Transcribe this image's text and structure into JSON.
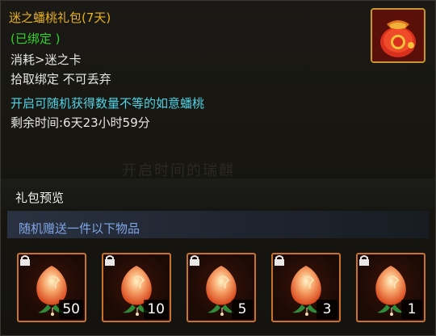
{
  "item": {
    "name": "迷之蟠桃礼包(7天)",
    "bound_status": "(已绑定 )",
    "consume": "消耗>迷之卡",
    "bind_rule": "拾取绑定 不可丢弃",
    "description": "开启可随机获得数量不等的如意蟠桃",
    "remaining_time": "剩余时间:6天23小时59分",
    "icon": "red-gift-bag-icon"
  },
  "watermark": "开启时间的瑞麒",
  "preview": {
    "title": "礼包预览",
    "random_note": "随机赠送一件以下物品",
    "items": [
      {
        "icon": "peach-icon",
        "quantity": "50"
      },
      {
        "icon": "peach-icon",
        "quantity": "10"
      },
      {
        "icon": "peach-icon",
        "quantity": "5"
      },
      {
        "icon": "peach-icon",
        "quantity": "3"
      },
      {
        "icon": "peach-icon",
        "quantity": "1"
      }
    ]
  },
  "colors": {
    "title": "#e9b21e",
    "bound": "#32d22a",
    "description": "#4fd3e6",
    "slot_border": "#c9732a"
  }
}
